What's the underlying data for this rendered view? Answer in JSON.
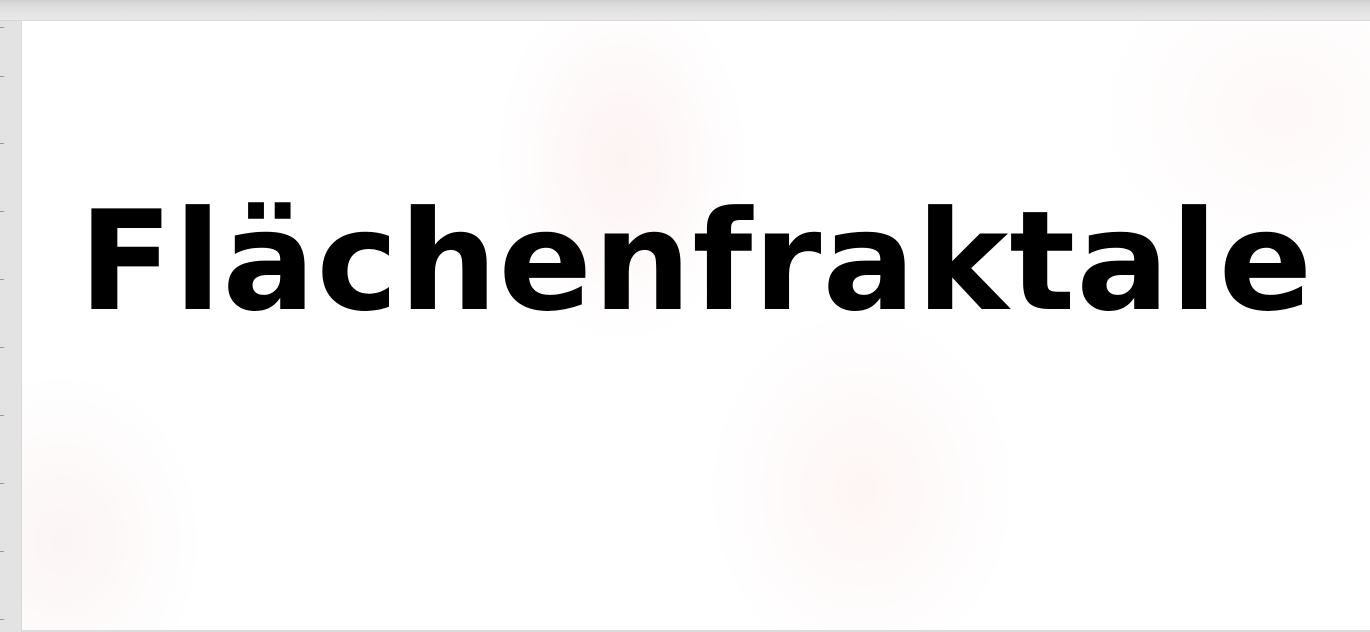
{
  "slide": {
    "title": "Flächenfraktale"
  },
  "colors": {
    "canvas": "#ffffff",
    "workspace": "#e2e2e2",
    "title_text": "#000000"
  }
}
